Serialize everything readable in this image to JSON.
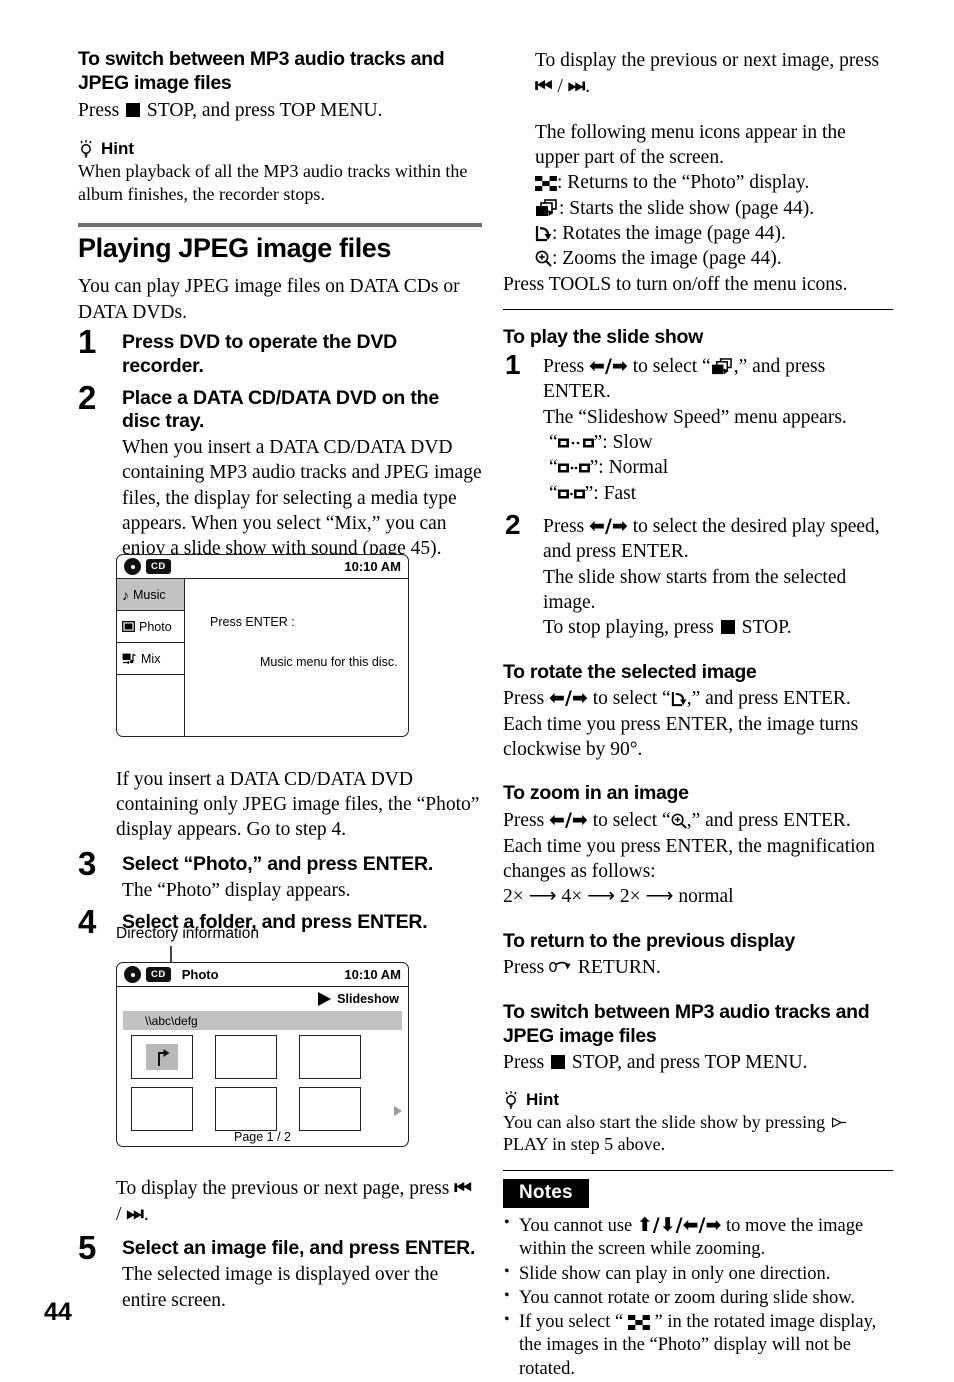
{
  "page": {
    "number": "44"
  },
  "left_column": {
    "section1": {
      "heading": "To switch between MP3 audio tracks and JPEG image files",
      "press_prefix": "Press",
      "press_suffix": "STOP, and press TOP MENU."
    },
    "hint1": {
      "label": "Hint",
      "text": "When playback of all the MP3 audio tracks within the album finishes, the recorder stops."
    },
    "main_heading": "Playing JPEG image files",
    "intro": "You can play JPEG image files on DATA CDs or DATA DVDs.",
    "steps": [
      {
        "num": "1",
        "title": "Press DVD to operate the DVD recorder.",
        "desc": ""
      },
      {
        "num": "2",
        "title": "Place a DATA CD/DATA DVD on the disc tray.",
        "desc": "When you insert a DATA CD/DATA DVD containing MP3 audio tracks and JPEG image files, the display for selecting a media type appears. When you select “Mix,” you can enjoy a slide show with sound (page 45)."
      },
      {
        "num": "3",
        "title": "Select “Photo,” and press ENTER.",
        "desc": "The “Photo” display appears."
      },
      {
        "num": "4",
        "title": "Select a folder, and press ENTER.",
        "desc": ""
      },
      {
        "num": "5",
        "title": "Select an image file, and press ENTER.",
        "desc": "The selected image is displayed over the entire screen."
      }
    ],
    "after_screen1": "If you insert a DATA CD/DATA DVD containing only JPEG image files, the “Photo” display appears. Go to step 4.",
    "directory_label": "Directory information",
    "prev_next_page": "To display the previous or next page, press",
    "prev_next_page_suffix": "."
  },
  "screen_media_select": {
    "time": "10:10 AM",
    "disc_tag": "CD",
    "items": [
      {
        "label": "Music",
        "icon": "music-note-icon",
        "selected": true
      },
      {
        "label": "Photo",
        "icon": "photo-frame-icon",
        "selected": false
      },
      {
        "label": "Mix",
        "icon": "mix-icon",
        "selected": false
      }
    ],
    "prompt": "Press ENTER :",
    "message": "Music menu for this disc."
  },
  "screen_photo_browser": {
    "time": "10:10 AM",
    "disc_tag": "CD",
    "title": "Photo",
    "slideshow_label": "Slideshow",
    "path": "\\\\abc\\defg",
    "page_indicator": "Page 1 / 2",
    "thumbnails": [
      "folder-up",
      "",
      "",
      "",
      "",
      ""
    ]
  },
  "right_column": {
    "prev_next_image": "To display the previous or next image, press",
    "prev_next_image_suffix": ".",
    "menu_icons_intro": "The following menu icons appear in the upper part of the screen.",
    "menu_icons": [
      {
        "icon": "checkerboard-thumbnail-icon",
        "text": ": Returns to the “Photo” display."
      },
      {
        "icon": "slideshow-icon",
        "text": ": Starts the slide show (page 44)."
      },
      {
        "icon": "rotate-icon",
        "text": ": Rotates the image (page 44)."
      },
      {
        "icon": "zoom-in-icon",
        "text": ": Zooms the image (page 44)."
      }
    ],
    "tools_note": "Press TOOLS to turn on/off the menu icons.",
    "slideshow_section": {
      "heading": "To play the slide show",
      "step1": {
        "num": "1",
        "lead": "Press",
        "mid": "to select “",
        "tail": ",” and press ENTER.",
        "line2": "The “Slideshow Speed” menu appears.",
        "speeds": [
          {
            "icon": "speed-slow-icon",
            "label": "”: Slow"
          },
          {
            "icon": "speed-normal-icon",
            "label": "”: Normal"
          },
          {
            "icon": "speed-fast-icon",
            "label": "”: Fast"
          }
        ]
      },
      "step2": {
        "num": "2",
        "lead": "Press",
        "tail": "to select the desired play speed, and press ENTER.",
        "line2": "The slide show starts from the selected image.",
        "line3_prefix": "To stop playing, press",
        "line3_suffix": "STOP."
      }
    },
    "rotate_section": {
      "heading": "To rotate the selected image",
      "lead": "Press",
      "mid": "to select “",
      "tail": ",” and press ENTER.",
      "body": "Each time you press ENTER, the image turns clockwise by 90°."
    },
    "zoom_section": {
      "heading": "To zoom in an image",
      "lead": "Press",
      "mid": "to select “",
      "tail": ",” and press ENTER.",
      "body": "Each time you press ENTER, the magnification changes as follows:",
      "sequence": "2× ⟶ 4× ⟶ 2× ⟶ normal"
    },
    "return_section": {
      "heading": "To return to the previous display",
      "prefix": "Press",
      "suffix": "RETURN."
    },
    "switch_section": {
      "heading": "To switch between MP3 audio tracks and JPEG image files",
      "prefix": "Press",
      "suffix": "STOP, and press TOP MENU."
    },
    "hint2": {
      "label": "Hint",
      "prefix": "You can also start the slide show by pressing",
      "suffix": "PLAY in step 5 above."
    },
    "notes": {
      "title": "Notes",
      "items": [
        {
          "prefix": "You cannot use",
          "suffix": "to move the image within the screen while zooming.",
          "has_arrows": true
        },
        {
          "prefix": "Slide show can play in only one direction.",
          "suffix": "",
          "has_arrows": false
        },
        {
          "prefix": "You cannot rotate or zoom during slide show.",
          "suffix": "",
          "has_arrows": false
        },
        {
          "prefix": "If you select “",
          "suffix": "” in the rotated image display, the images in the “Photo” display will not be rotated.",
          "has_checker": true
        }
      ]
    }
  }
}
